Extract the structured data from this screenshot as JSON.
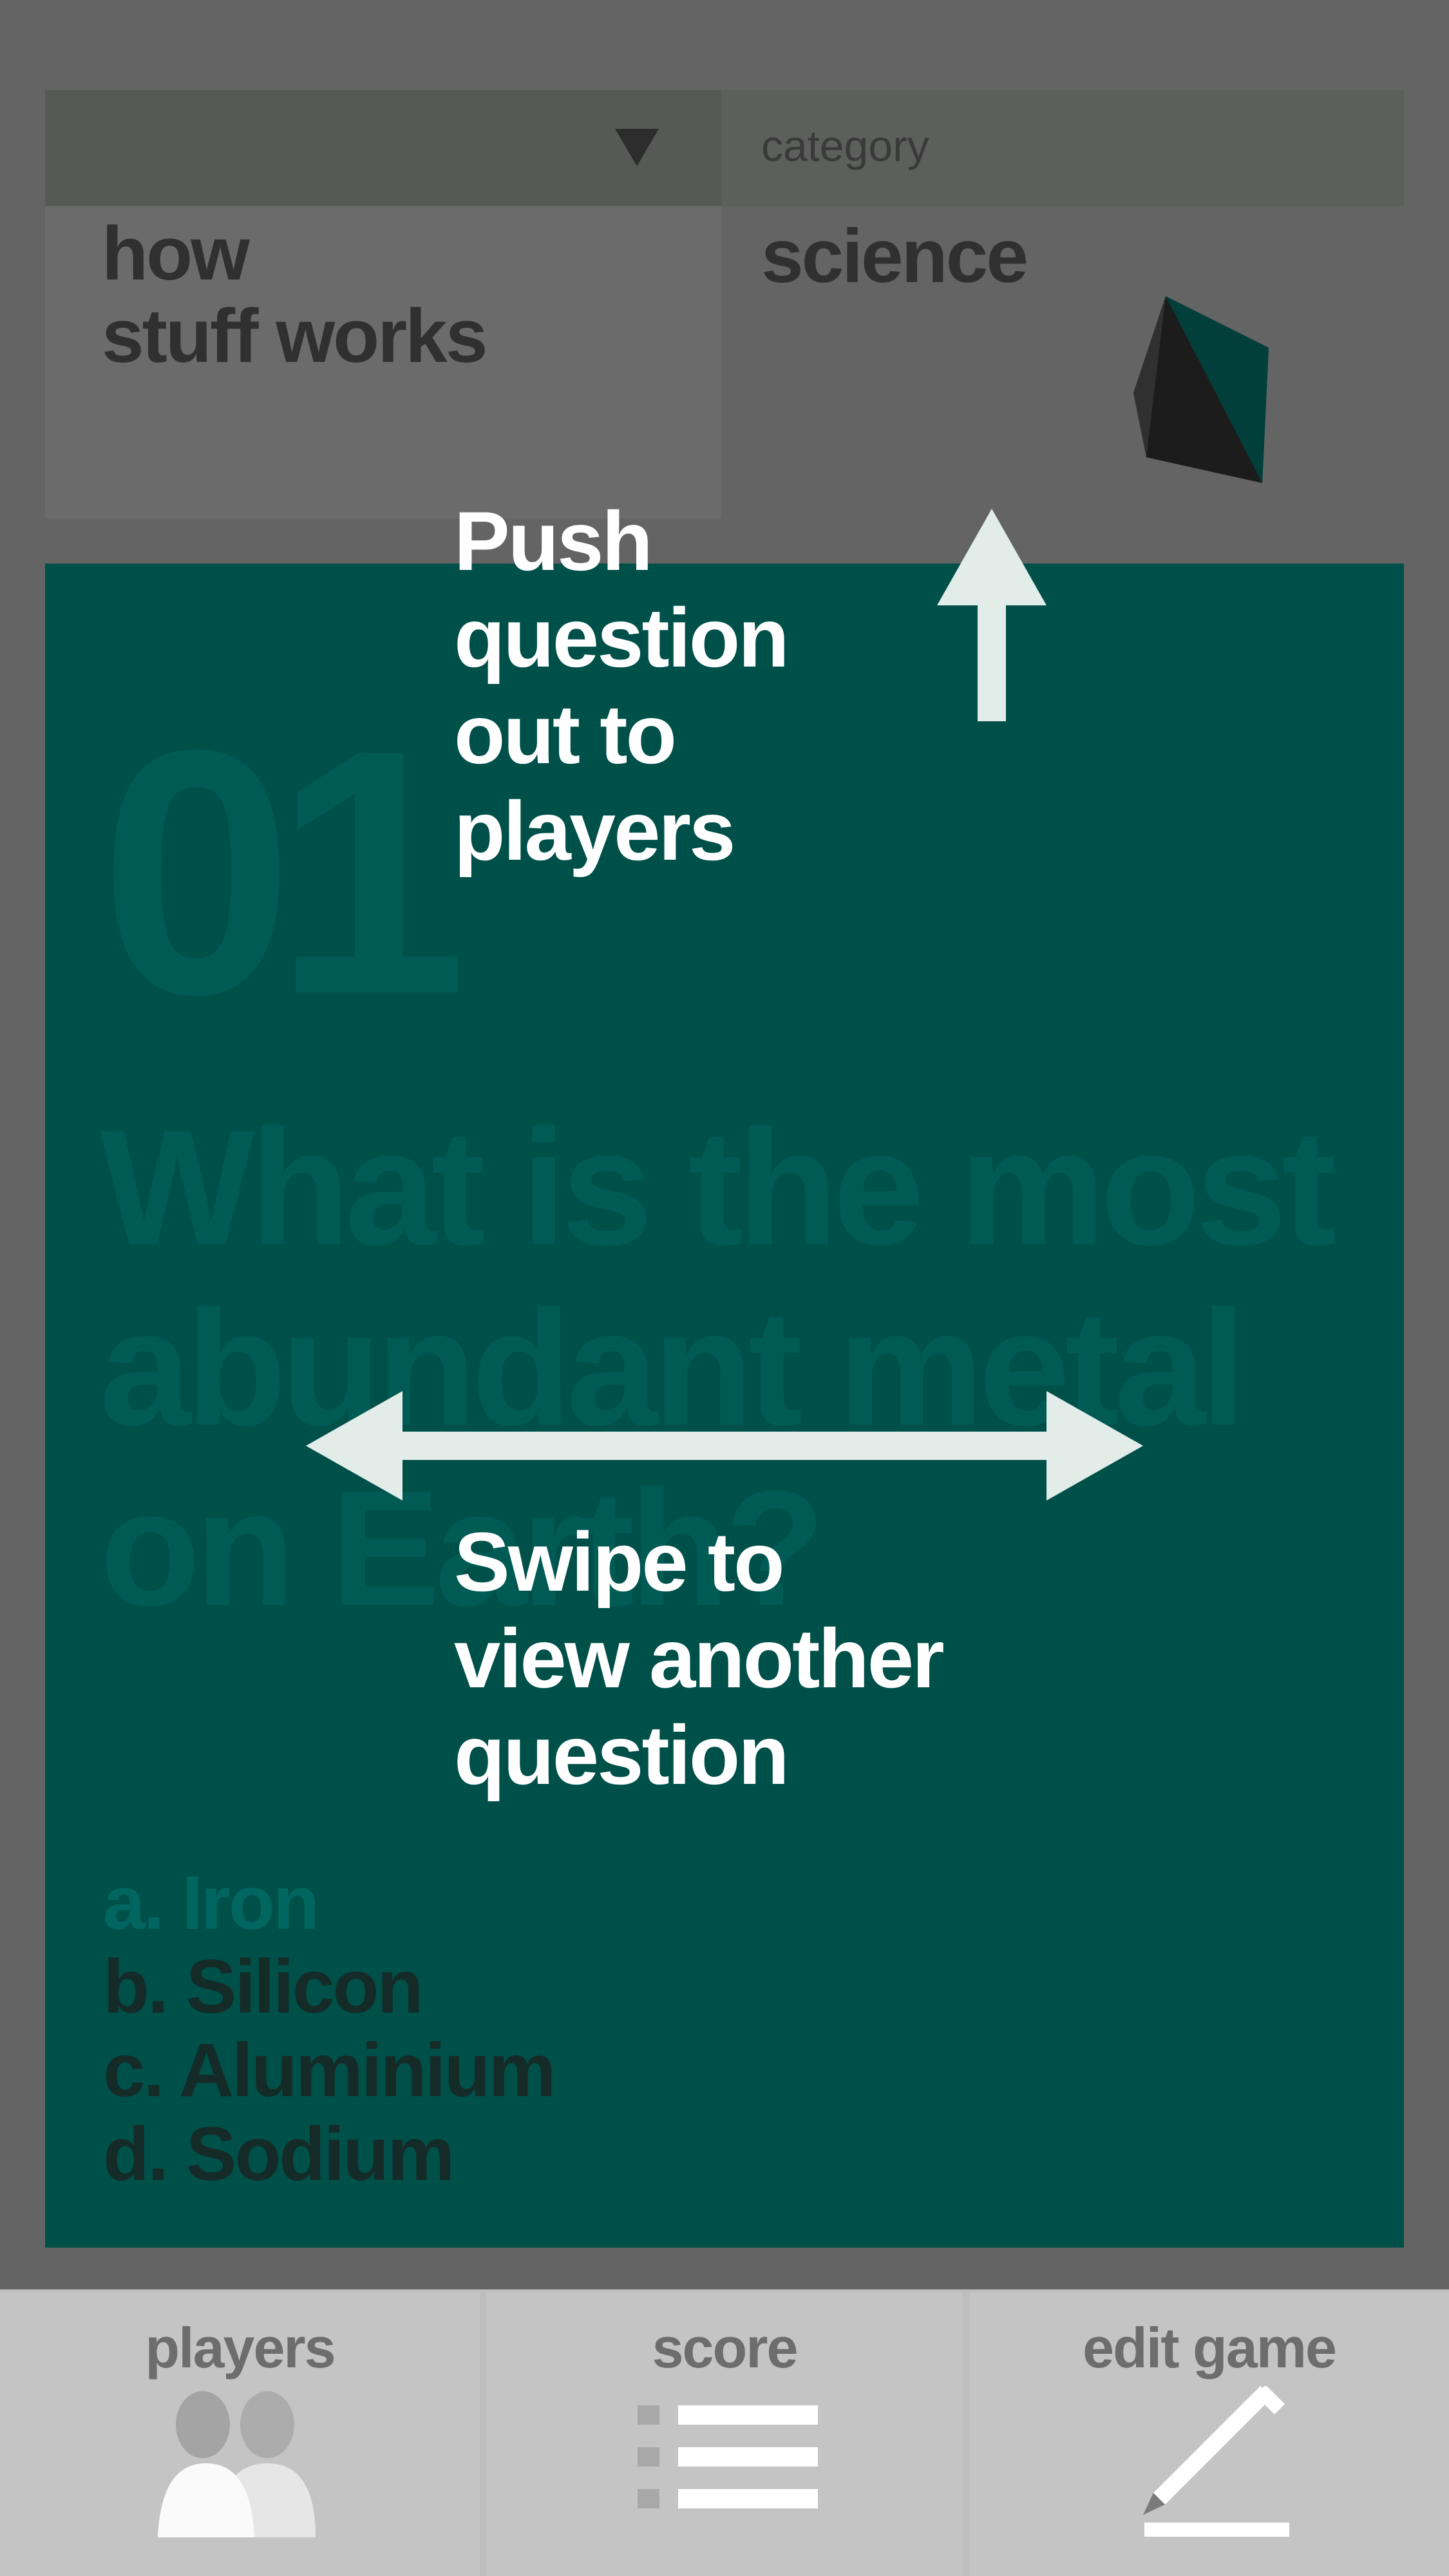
{
  "header": {
    "dropdown_icon": "triangle-down-icon",
    "topic_line1": "how",
    "topic_line2": "stuff works",
    "category_label": "category",
    "category_value": "science"
  },
  "question": {
    "number": "01",
    "text": "What is the most abundant metal on Earth?",
    "answers": [
      "a. Iron",
      "b. Silicon",
      "c. Aluminium",
      "d. Sodium"
    ]
  },
  "hints": {
    "push_lines": [
      "Push",
      "question",
      "out to",
      "players"
    ],
    "swipe_lines": [
      "Swipe to",
      "view another",
      "question"
    ]
  },
  "tabs": [
    {
      "label": "players",
      "icon": "players-icon"
    },
    {
      "label": "score",
      "icon": "list-icon"
    },
    {
      "label": "edit game",
      "icon": "pencil-icon"
    }
  ],
  "colors": {
    "background": "#646464",
    "card": "#00504a",
    "tabbar": "#c4c4c4"
  }
}
